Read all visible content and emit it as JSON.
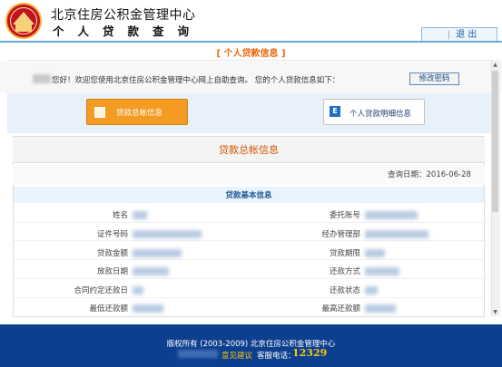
{
  "header": {
    "org_name": "北京住房公积金管理中心",
    "sub_title": "个人贷款查询",
    "logout_label": "退 出",
    "separator": "|"
  },
  "section": {
    "title": "[ 个人贷款信息 ]"
  },
  "greeting": {
    "text": "您好！欢迎您使用北京住房公积金管理中心网上自助查询。 您的个人贷款信息如下：",
    "change_password_label": "修改密码"
  },
  "tabs": {
    "summary_label": "贷款总帐信息",
    "detail_label": "个人贷款明细信息",
    "detail_icon_letter": "E"
  },
  "panel": {
    "title": "贷款总帐信息",
    "query_date_label": "查询日期：",
    "query_date": "2016-06-28",
    "basic_info_title": "贷款基本信息",
    "left_fields": [
      "姓名",
      "证件号码",
      "贷款金额",
      "放款日期",
      "合同约定还款日",
      "最低还款额"
    ],
    "right_fields": [
      "委托账号",
      "经办管理部",
      "贷款期限",
      "还款方式",
      "还款状态",
      "最高还款额"
    ]
  },
  "footer": {
    "copyright": "版权所有 (2003-2009) 北京住房公积金管理中心",
    "feedback_label": "意见建议",
    "hotline_label": "客服电话：",
    "hotline_number": "12329"
  },
  "colors": {
    "accent_orange": "#f39b22",
    "title_orange": "#e86a10",
    "footer_blue": "#0c3f8e",
    "link_blue": "#1e64a8",
    "hotline_yellow": "#f5c518"
  },
  "icons": {
    "logo": "housing-fund-logo-icon",
    "summary": "ledger-icon",
    "detail": "excel-doc-icon",
    "scroll_up": "triangle-up-icon",
    "scroll_down": "triangle-down-icon"
  }
}
